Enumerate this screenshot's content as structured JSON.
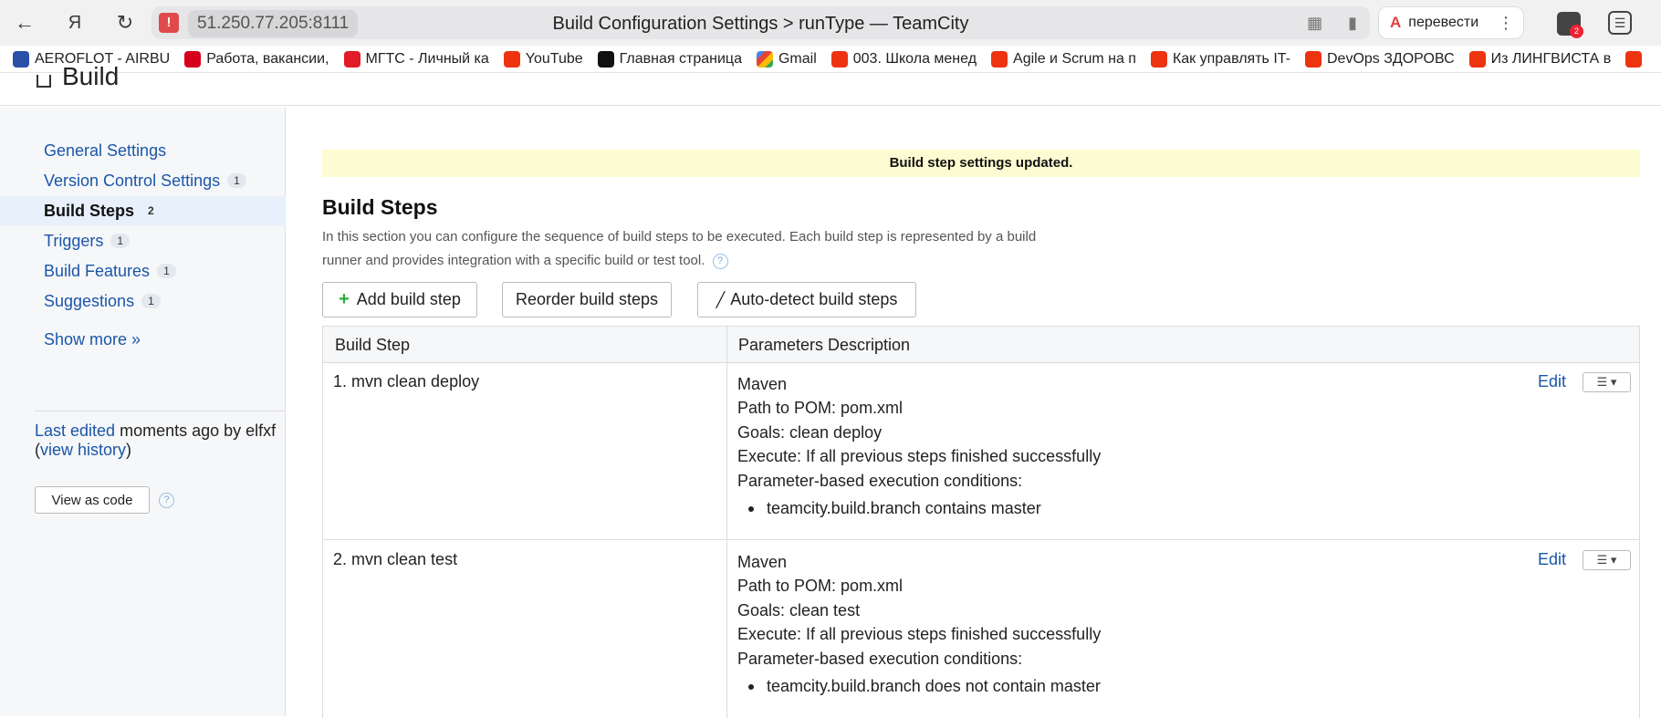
{
  "browser": {
    "url": "51.250.77.205:8111",
    "tab_title": "Build Configuration Settings > runType — TeamCity",
    "translate_label": "перевести",
    "ext_badge": "2",
    "bookmarks": [
      {
        "label": "AEROFLOT - AIRBU",
        "icon": "aeroflot-icon"
      },
      {
        "label": "Работа, вакансии,",
        "icon": "hh-icon"
      },
      {
        "label": "МГТС - Личный ка",
        "icon": "mgts-icon"
      },
      {
        "label": "YouTube",
        "icon": "youtube-icon"
      },
      {
        "label": "Главная страница",
        "icon": "star-icon"
      },
      {
        "label": "Gmail",
        "icon": "gmail-icon"
      },
      {
        "label": "003. Школа менед",
        "icon": "youtube-icon"
      },
      {
        "label": "Agile и Scrum на п",
        "icon": "youtube-icon"
      },
      {
        "label": "Как управлять IT-",
        "icon": "youtube-icon"
      },
      {
        "label": "DevOps ЗДОРОВС",
        "icon": "youtube-icon"
      },
      {
        "label": "Из ЛИНГВИСТА в",
        "icon": "youtube-icon"
      }
    ]
  },
  "header": {
    "title": "Build"
  },
  "sidebar": {
    "items": [
      {
        "label": "General Settings",
        "count": ""
      },
      {
        "label": "Version Control Settings",
        "count": "1"
      },
      {
        "label": "Build Steps",
        "count": "2"
      },
      {
        "label": "Triggers",
        "count": "1"
      },
      {
        "label": "Build Features",
        "count": "1"
      },
      {
        "label": "Suggestions",
        "count": "1"
      }
    ],
    "show_more": "Show more »",
    "last_edited_link": "Last edited",
    "last_edited_text": " moments ago by elfxf",
    "view_history": "view history",
    "view_as_code": "View as code"
  },
  "main": {
    "notice": "Build step settings updated.",
    "heading": "Build Steps",
    "description": "In this section you can configure the sequence of build steps to be executed. Each build step is represented by a build runner and provides integration with a specific build or test tool.",
    "buttons": {
      "add": "Add build step",
      "reorder": "Reorder build steps",
      "autodetect": "Auto-detect build steps"
    },
    "table": {
      "headers": [
        "Build Step",
        "Parameters Description"
      ],
      "edit_label": "Edit",
      "rows": [
        {
          "name": "1. mvn clean deploy",
          "runner": "Maven",
          "pom": "Path to POM: pom.xml",
          "goals": "Goals: clean deploy",
          "execute": "Execute: If all previous steps finished successfully",
          "conditions_label": "Parameter-based execution conditions:",
          "condition": "teamcity.build.branch contains master"
        },
        {
          "name": "2. mvn clean test",
          "runner": "Maven",
          "pom": "Path to POM: pom.xml",
          "goals": "Goals: clean test",
          "execute": "Execute: If all previous steps finished successfully",
          "conditions_label": "Parameter-based execution conditions:",
          "condition": "teamcity.build.branch does not contain master"
        }
      ]
    }
  }
}
